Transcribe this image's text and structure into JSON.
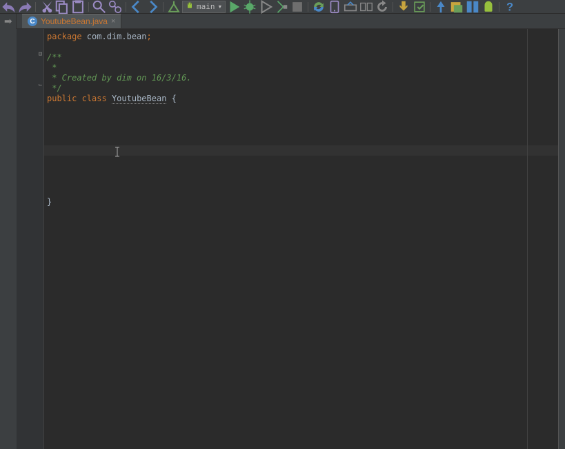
{
  "toolbar": {
    "run_config": "main"
  },
  "tab": {
    "icon_letter": "C",
    "filename": "YoutubeBean.java"
  },
  "code": {
    "line1_kw": "package",
    "line1_pkg": " com.dim.bean",
    "line1_semi": ";",
    "line3": "/**",
    "line4": " *",
    "line5": " * Created by dim on 16/3/16.",
    "line6": " */",
    "line7_kw1": "public",
    "line7_sp1": " ",
    "line7_kw2": "class",
    "line7_sp2": " ",
    "line7_cls": "YoutubeBean",
    "line7_brace": " {",
    "line_close": "}"
  }
}
